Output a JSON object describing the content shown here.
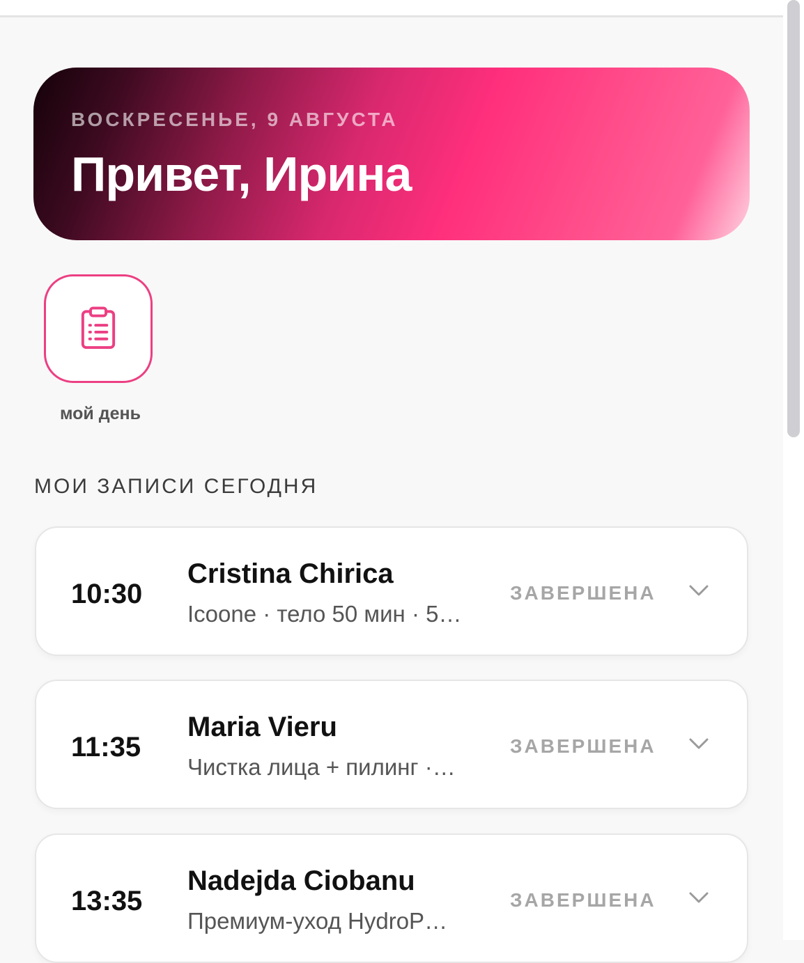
{
  "header": {
    "date": "ВОСКРЕСЕНЬЕ, 9 АВГУСТА",
    "greeting": "Привет, Ирина"
  },
  "quick_actions": [
    {
      "label": "мой день",
      "icon": "clipboard-list-icon"
    }
  ],
  "appointments_section": {
    "title": "МОИ ЗАПИСИ СЕГОДНЯ",
    "items": [
      {
        "time": "10:30",
        "client": "Cristina Chirica",
        "service": "Icoone · тело 50 мин · 5…",
        "status": "ЗАВЕРШЕНА"
      },
      {
        "time": "11:35",
        "client": "Maria Vieru",
        "service": "Чистка лица + пилинг ·…",
        "status": "ЗАВЕРШЕНА"
      },
      {
        "time": "13:35",
        "client": "Nadejda Ciobanu",
        "service": "Премиум-уход HydroP…",
        "status": "ЗАВЕРШЕНА"
      }
    ]
  },
  "colors": {
    "accent": "#ec3f83",
    "background": "#f8f8f8",
    "status_muted": "#a6a6a6"
  }
}
